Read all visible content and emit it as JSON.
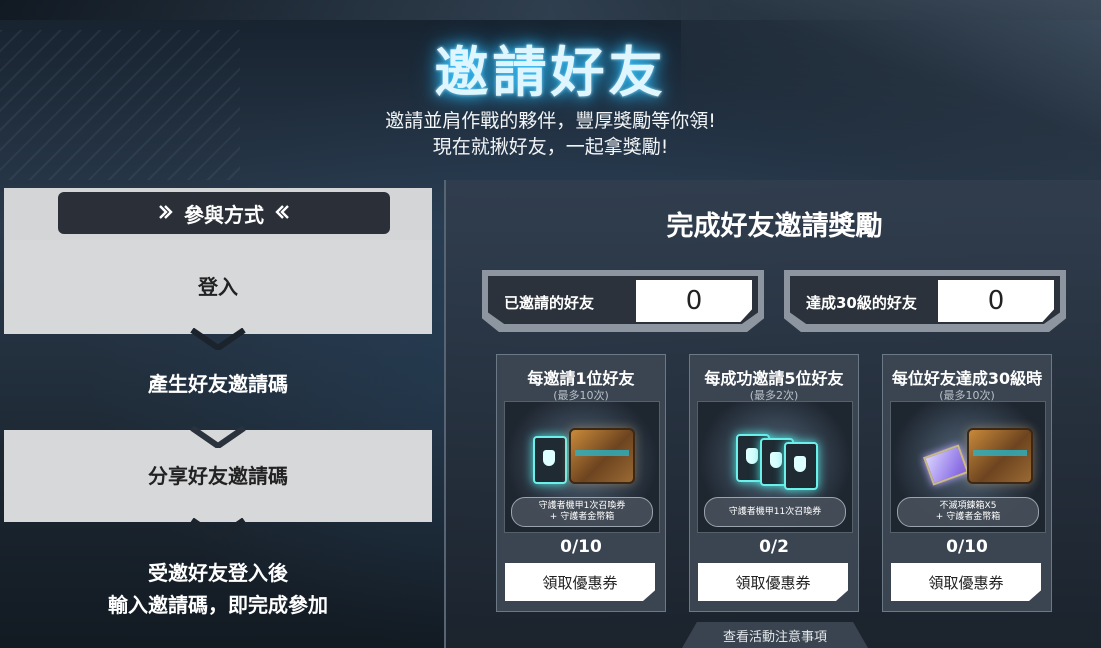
{
  "hero": {
    "title": "邀請好友",
    "subtitle_line1": "邀請並肩作戰的夥伴，豐厚獎勵等你領!",
    "subtitle_line2": "現在就揪好友，一起拿獎勵!"
  },
  "how_to": {
    "header": "參與方式",
    "steps": [
      {
        "label": "登入"
      },
      {
        "label": "產生好友邀請碼"
      },
      {
        "label": "分享好友邀請碼"
      },
      {
        "label_line1": "受邀好友登入後",
        "label_line2": "輸入邀請碼，即完成參加"
      }
    ]
  },
  "rewards": {
    "title": "完成好友邀請獎勵",
    "counters": [
      {
        "label": "已邀請的好友",
        "value": "0"
      },
      {
        "label": "達成30級的好友",
        "value": "0"
      }
    ],
    "cards": [
      {
        "title": "每邀請1位好友",
        "limit": "(最多10次)",
        "desc_line1": "守護者機甲1次召喚券",
        "desc_line2": "+ 守護者金幣箱",
        "progress": "0/10",
        "button": "領取優惠券"
      },
      {
        "title": "每成功邀請5位好友",
        "limit": "(最多2次)",
        "desc_line1": "守護者機甲11次召喚券",
        "desc_line2": "",
        "progress": "0/2",
        "button": "領取優惠券"
      },
      {
        "title": "每位好友達成30級時",
        "limit": "(最多10次)",
        "desc_line1": "不滅項鍊箱X5",
        "desc_line2": "+ 守護者金幣箱",
        "progress": "0/10",
        "button": "領取優惠券"
      }
    ],
    "notice_button": "查看活動注意事項"
  }
}
